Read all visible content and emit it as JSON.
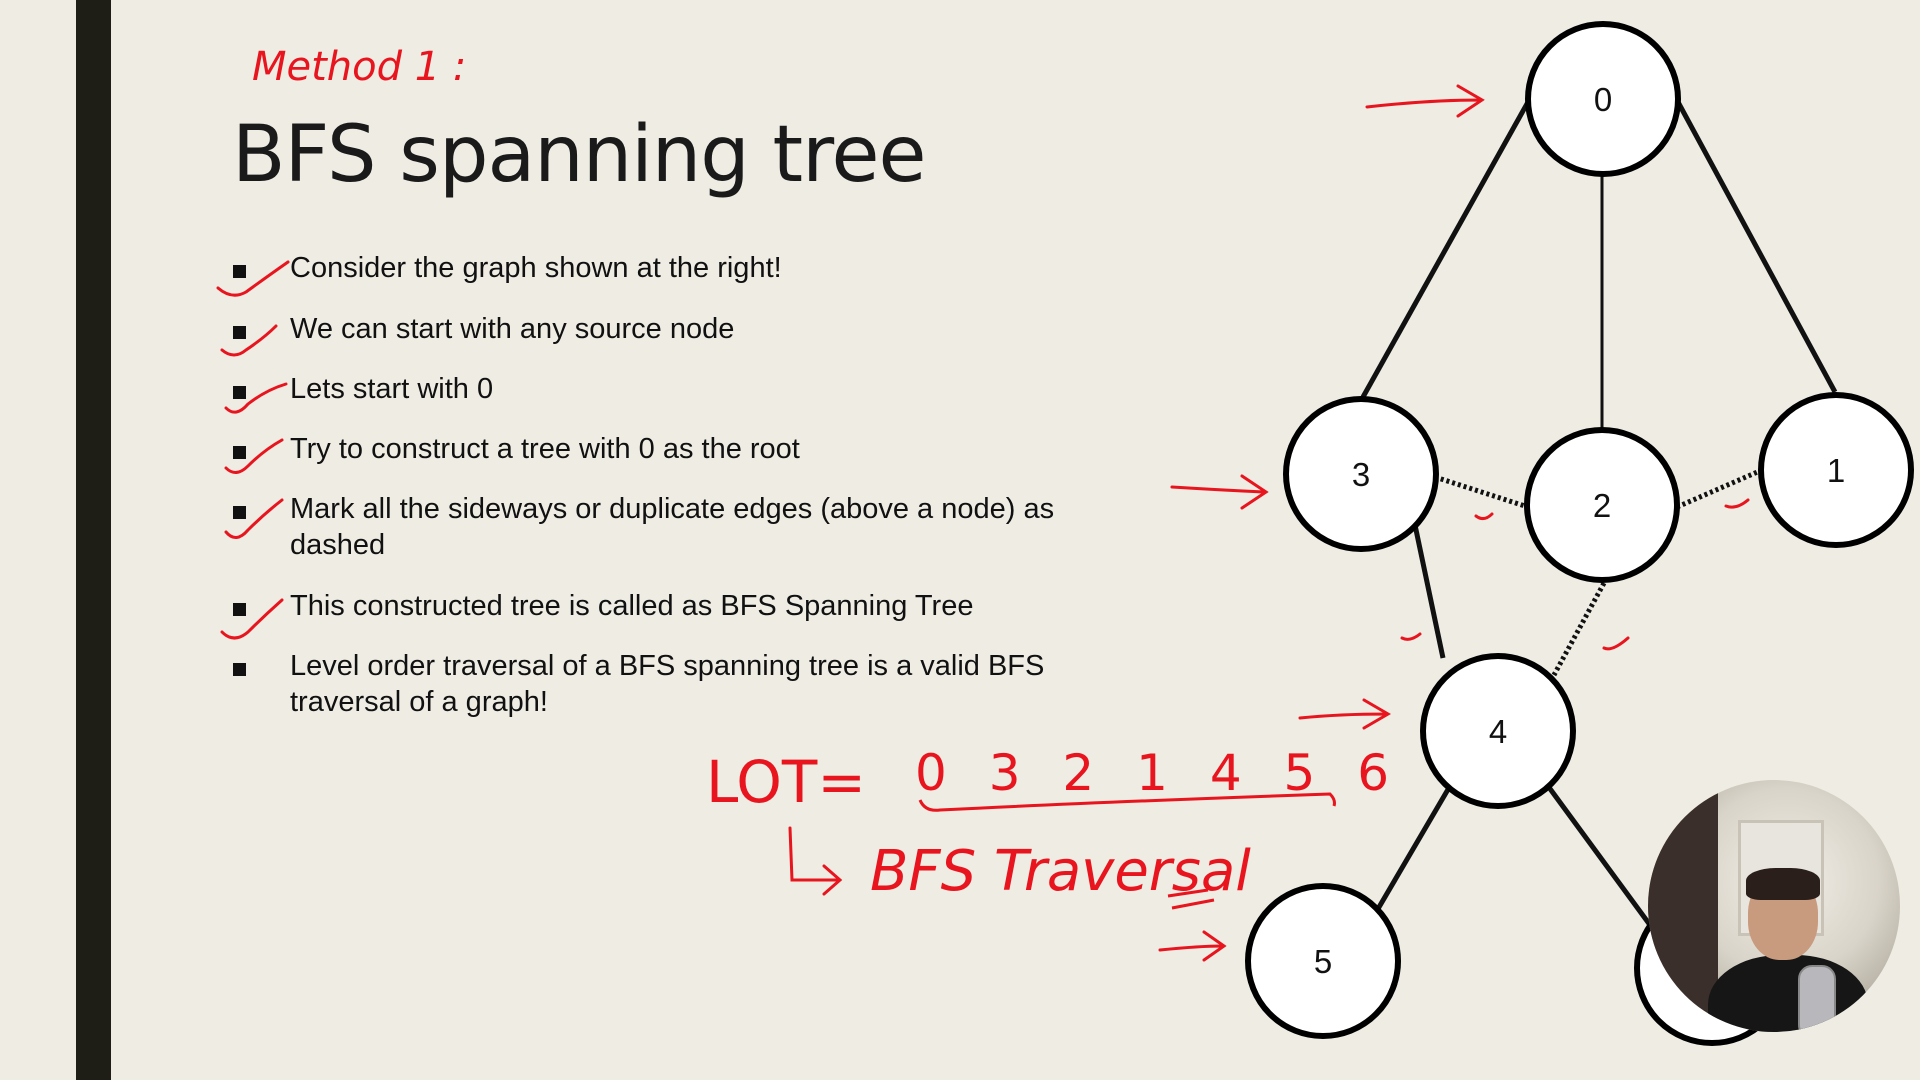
{
  "slide": {
    "title": "BFS spanning tree",
    "bullets": [
      "Consider the graph shown at the right!",
      "We can start with any source node",
      "Lets start with 0",
      "Try to construct a tree with 0 as the root",
      "Mark all the sideways or duplicate edges (above a node) as dashed",
      "This constructed tree is called as BFS Spanning Tree",
      "Level order traversal of a BFS spanning tree is a valid BFS traversal of a graph!"
    ]
  },
  "annotations": {
    "method": "Method 1 :",
    "lot_prefix": "LOT=",
    "lot_sequence": "0 3 2 1 4 5 6",
    "bfs_traversal": "BFS Traversal"
  },
  "graph": {
    "nodes": [
      "0",
      "3",
      "2",
      "1",
      "4",
      "5"
    ],
    "tree_edges": [
      [
        "0",
        "3"
      ],
      [
        "0",
        "2"
      ],
      [
        "0",
        "1"
      ],
      [
        "3",
        "4"
      ],
      [
        "4",
        "5"
      ],
      [
        "4",
        "6"
      ]
    ],
    "dashed_edges": [
      [
        "3",
        "2"
      ],
      [
        "2",
        "1"
      ],
      [
        "2",
        "4"
      ]
    ]
  },
  "colors": {
    "ink": "#e8141e",
    "background": "#eeece3",
    "sidebar": "#1e1e16"
  }
}
